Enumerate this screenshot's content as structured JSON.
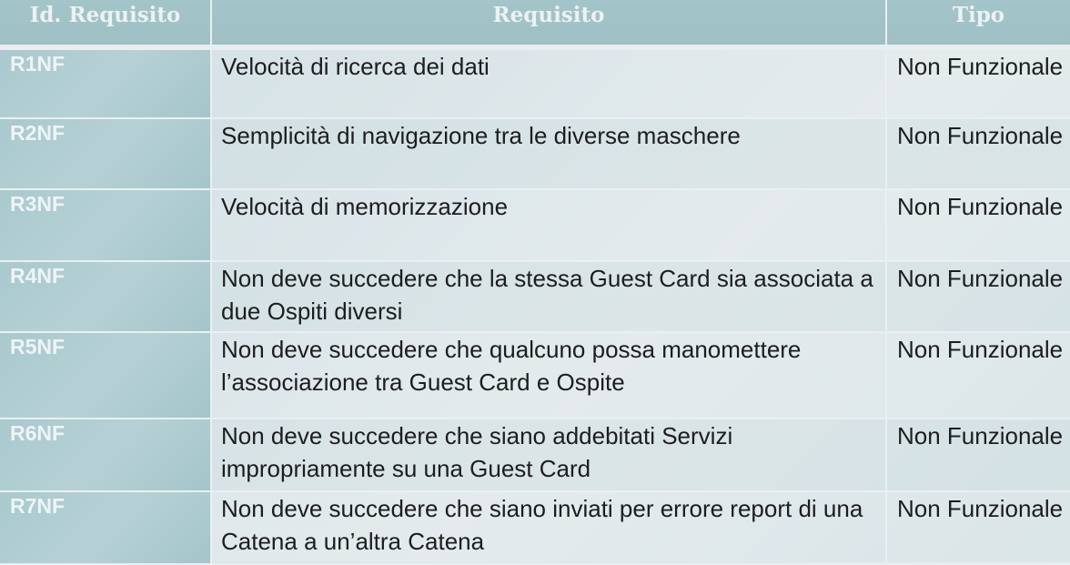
{
  "header": {
    "id_label": "Id. Requisito",
    "req_label": "Requisito",
    "type_label": "Tipo"
  },
  "rows": [
    {
      "id": "R1NF",
      "requisito": "Velocità di ricerca dei dati",
      "tipo": "Non Funzionale"
    },
    {
      "id": "R2NF",
      "requisito": "Semplicità di navigazione tra le diverse maschere",
      "tipo": "Non Funzionale"
    },
    {
      "id": "R3NF",
      "requisito": "Velocità di memorizzazione",
      "tipo": "Non Funzionale"
    },
    {
      "id": "R4NF",
      "requisito": "Non deve succedere che la stessa Guest Card sia associata a due Ospiti diversi",
      "tipo": "Non Funzionale"
    },
    {
      "id": "R5NF",
      "requisito": "Non deve succedere che qualcuno possa manomettere l’associazione tra Guest Card e Ospite",
      "tipo": "Non Funzionale"
    },
    {
      "id": "R6NF",
      "requisito": "Non deve succedere che siano addebitati Servizi impropriamente su una Guest Card",
      "tipo": "Non Funzionale"
    },
    {
      "id": "R7NF",
      "requisito": "Non deve succedere che siano inviati per errore report di una Catena a un’altra Catena",
      "tipo": "Non Funzionale"
    }
  ]
}
